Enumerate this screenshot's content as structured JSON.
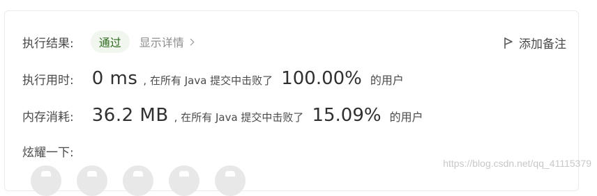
{
  "result": {
    "label": "执行结果:",
    "status": "通过",
    "details_link": "显示详情",
    "add_note": "添加备注"
  },
  "runtime": {
    "label": "执行用时:",
    "value": "0 ms",
    "beat_text": ", 在所有 Java 提交中击败了",
    "percent": "100.00%",
    "suffix": "的用户"
  },
  "memory": {
    "label": "内存消耗:",
    "value": "36.2 MB",
    "beat_text": ", 在所有 Java 提交中击败了",
    "percent": "15.09%",
    "suffix": "的用户"
  },
  "share": {
    "label": "炫耀一下:",
    "icons": [
      "share-icon-1",
      "share-icon-2",
      "share-icon-3",
      "share-icon-4",
      "share-icon-5"
    ]
  },
  "watermark": "https://blog.csdn.net/qq_41115379",
  "colors": {
    "status_bg": "#f1f6ee",
    "status_text": "#2e6b1f",
    "muted": "#8c8c8c"
  }
}
